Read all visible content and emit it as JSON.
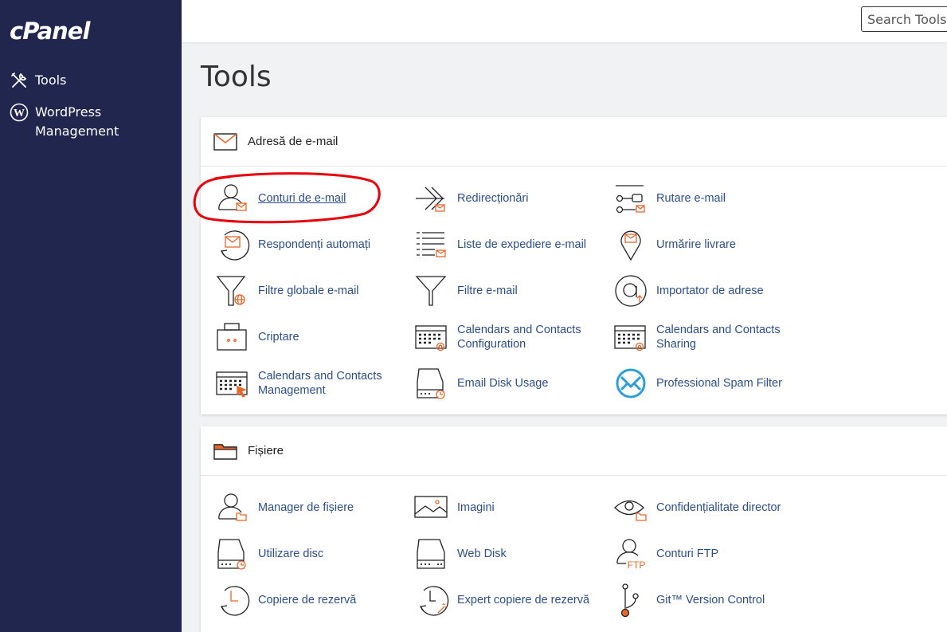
{
  "sidebar": {
    "logo": "cPanel",
    "items": [
      {
        "label": "Tools",
        "icon": "tools-icon"
      },
      {
        "label": "WordPress Management",
        "icon": "wordpress-icon"
      }
    ]
  },
  "topbar": {
    "search_placeholder": "Search Tools ("
  },
  "page_title": "Tools",
  "sections": [
    {
      "title": "Adresă de e-mail",
      "icon": "envelope-icon",
      "tools": [
        {
          "label": "Conturi de e-mail",
          "icon": "email-accounts-icon"
        },
        {
          "label": "Redirecționări",
          "icon": "forwarders-icon"
        },
        {
          "label": "Rutare e-mail",
          "icon": "email-routing-icon"
        },
        {
          "label": "Respondenți automați",
          "icon": "autoresponders-icon"
        },
        {
          "label": "Liste de expediere e-mail",
          "icon": "mailing-lists-icon"
        },
        {
          "label": "Urmărire livrare",
          "icon": "track-delivery-icon"
        },
        {
          "label": "Filtre globale e-mail",
          "icon": "global-filters-icon"
        },
        {
          "label": "Filtre e-mail",
          "icon": "email-filters-icon"
        },
        {
          "label": "Importator de adrese",
          "icon": "address-importer-icon"
        },
        {
          "label": "Criptare",
          "icon": "encryption-icon"
        },
        {
          "label": "Calendars and Contacts Configuration",
          "icon": "calendar-config-icon"
        },
        {
          "label": "Calendars and Contacts Sharing",
          "icon": "calendar-sharing-icon"
        },
        {
          "label": "Calendars and Contacts Management",
          "icon": "calendar-management-icon"
        },
        {
          "label": "Email Disk Usage",
          "icon": "email-disk-usage-icon"
        },
        {
          "label": "Professional Spam Filter",
          "icon": "spam-filter-icon"
        }
      ]
    },
    {
      "title": "Fișiere",
      "icon": "folder-icon",
      "tools": [
        {
          "label": "Manager de fișiere",
          "icon": "file-manager-icon"
        },
        {
          "label": "Imagini",
          "icon": "images-icon"
        },
        {
          "label": "Confidențialitate director",
          "icon": "directory-privacy-icon"
        },
        {
          "label": "Utilizare disc",
          "icon": "disk-usage-icon"
        },
        {
          "label": "Web Disk",
          "icon": "web-disk-icon"
        },
        {
          "label": "Conturi FTP",
          "icon": "ftp-accounts-icon"
        },
        {
          "label": "Copiere de rezervă",
          "icon": "backup-icon"
        },
        {
          "label": "Expert copiere de rezervă",
          "icon": "backup-wizard-icon"
        },
        {
          "label": "Git™ Version Control",
          "icon": "git-icon"
        }
      ]
    }
  ],
  "ftp_icon_text": "FTP",
  "colors": {
    "sidebar_bg": "#20264e",
    "link": "#2b4f8e",
    "accent": "#e8672c",
    "annotation": "#e8000b",
    "spam_filter": "#2d9fd8"
  }
}
